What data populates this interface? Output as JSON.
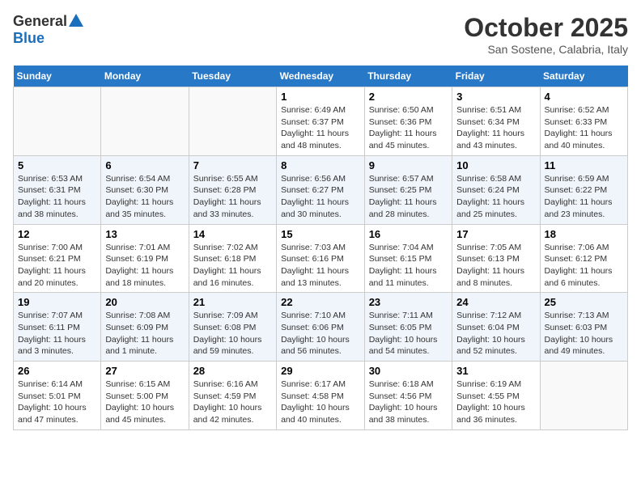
{
  "logo": {
    "general": "General",
    "blue": "Blue"
  },
  "header": {
    "title": "October 2025",
    "subtitle": "San Sostene, Calabria, Italy"
  },
  "weekdays": [
    "Sunday",
    "Monday",
    "Tuesday",
    "Wednesday",
    "Thursday",
    "Friday",
    "Saturday"
  ],
  "weeks": [
    [
      {
        "day": "",
        "content": ""
      },
      {
        "day": "",
        "content": ""
      },
      {
        "day": "",
        "content": ""
      },
      {
        "day": "1",
        "content": "Sunrise: 6:49 AM\nSunset: 6:37 PM\nDaylight: 11 hours\nand 48 minutes."
      },
      {
        "day": "2",
        "content": "Sunrise: 6:50 AM\nSunset: 6:36 PM\nDaylight: 11 hours\nand 45 minutes."
      },
      {
        "day": "3",
        "content": "Sunrise: 6:51 AM\nSunset: 6:34 PM\nDaylight: 11 hours\nand 43 minutes."
      },
      {
        "day": "4",
        "content": "Sunrise: 6:52 AM\nSunset: 6:33 PM\nDaylight: 11 hours\nand 40 minutes."
      }
    ],
    [
      {
        "day": "5",
        "content": "Sunrise: 6:53 AM\nSunset: 6:31 PM\nDaylight: 11 hours\nand 38 minutes."
      },
      {
        "day": "6",
        "content": "Sunrise: 6:54 AM\nSunset: 6:30 PM\nDaylight: 11 hours\nand 35 minutes."
      },
      {
        "day": "7",
        "content": "Sunrise: 6:55 AM\nSunset: 6:28 PM\nDaylight: 11 hours\nand 33 minutes."
      },
      {
        "day": "8",
        "content": "Sunrise: 6:56 AM\nSunset: 6:27 PM\nDaylight: 11 hours\nand 30 minutes."
      },
      {
        "day": "9",
        "content": "Sunrise: 6:57 AM\nSunset: 6:25 PM\nDaylight: 11 hours\nand 28 minutes."
      },
      {
        "day": "10",
        "content": "Sunrise: 6:58 AM\nSunset: 6:24 PM\nDaylight: 11 hours\nand 25 minutes."
      },
      {
        "day": "11",
        "content": "Sunrise: 6:59 AM\nSunset: 6:22 PM\nDaylight: 11 hours\nand 23 minutes."
      }
    ],
    [
      {
        "day": "12",
        "content": "Sunrise: 7:00 AM\nSunset: 6:21 PM\nDaylight: 11 hours\nand 20 minutes."
      },
      {
        "day": "13",
        "content": "Sunrise: 7:01 AM\nSunset: 6:19 PM\nDaylight: 11 hours\nand 18 minutes."
      },
      {
        "day": "14",
        "content": "Sunrise: 7:02 AM\nSunset: 6:18 PM\nDaylight: 11 hours\nand 16 minutes."
      },
      {
        "day": "15",
        "content": "Sunrise: 7:03 AM\nSunset: 6:16 PM\nDaylight: 11 hours\nand 13 minutes."
      },
      {
        "day": "16",
        "content": "Sunrise: 7:04 AM\nSunset: 6:15 PM\nDaylight: 11 hours\nand 11 minutes."
      },
      {
        "day": "17",
        "content": "Sunrise: 7:05 AM\nSunset: 6:13 PM\nDaylight: 11 hours\nand 8 minutes."
      },
      {
        "day": "18",
        "content": "Sunrise: 7:06 AM\nSunset: 6:12 PM\nDaylight: 11 hours\nand 6 minutes."
      }
    ],
    [
      {
        "day": "19",
        "content": "Sunrise: 7:07 AM\nSunset: 6:11 PM\nDaylight: 11 hours\nand 3 minutes."
      },
      {
        "day": "20",
        "content": "Sunrise: 7:08 AM\nSunset: 6:09 PM\nDaylight: 11 hours\nand 1 minute."
      },
      {
        "day": "21",
        "content": "Sunrise: 7:09 AM\nSunset: 6:08 PM\nDaylight: 10 hours\nand 59 minutes."
      },
      {
        "day": "22",
        "content": "Sunrise: 7:10 AM\nSunset: 6:06 PM\nDaylight: 10 hours\nand 56 minutes."
      },
      {
        "day": "23",
        "content": "Sunrise: 7:11 AM\nSunset: 6:05 PM\nDaylight: 10 hours\nand 54 minutes."
      },
      {
        "day": "24",
        "content": "Sunrise: 7:12 AM\nSunset: 6:04 PM\nDaylight: 10 hours\nand 52 minutes."
      },
      {
        "day": "25",
        "content": "Sunrise: 7:13 AM\nSunset: 6:03 PM\nDaylight: 10 hours\nand 49 minutes."
      }
    ],
    [
      {
        "day": "26",
        "content": "Sunrise: 6:14 AM\nSunset: 5:01 PM\nDaylight: 10 hours\nand 47 minutes."
      },
      {
        "day": "27",
        "content": "Sunrise: 6:15 AM\nSunset: 5:00 PM\nDaylight: 10 hours\nand 45 minutes."
      },
      {
        "day": "28",
        "content": "Sunrise: 6:16 AM\nSunset: 4:59 PM\nDaylight: 10 hours\nand 42 minutes."
      },
      {
        "day": "29",
        "content": "Sunrise: 6:17 AM\nSunset: 4:58 PM\nDaylight: 10 hours\nand 40 minutes."
      },
      {
        "day": "30",
        "content": "Sunrise: 6:18 AM\nSunset: 4:56 PM\nDaylight: 10 hours\nand 38 minutes."
      },
      {
        "day": "31",
        "content": "Sunrise: 6:19 AM\nSunset: 4:55 PM\nDaylight: 10 hours\nand 36 minutes."
      },
      {
        "day": "",
        "content": ""
      }
    ]
  ]
}
